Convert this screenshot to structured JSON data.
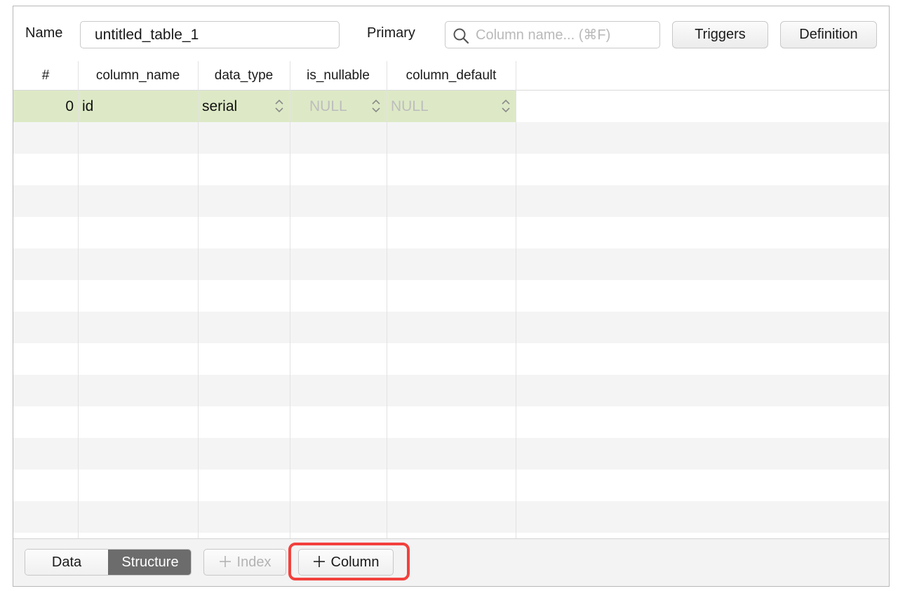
{
  "toolbar": {
    "name_label": "Name",
    "name_value": "untitled_table_1",
    "primary_label": "Primary",
    "search_placeholder": "Column name... (⌘F)",
    "search_icon": "search-icon",
    "triggers_label": "Triggers",
    "definition_label": "Definition"
  },
  "table": {
    "columns": [
      "#",
      "column_name",
      "data_type",
      "is_nullable",
      "column_default"
    ],
    "rows": [
      {
        "index": "0",
        "column_name": "id",
        "data_type": "serial",
        "is_nullable": "NULL",
        "column_default": "NULL"
      }
    ],
    "selected_row_color": "#dde9c6"
  },
  "bottombar": {
    "tabs": [
      "Data",
      "Structure"
    ],
    "active_tab": "Structure",
    "index_button": "Index",
    "column_button": "Column",
    "highlight_color": "#f2413d"
  }
}
